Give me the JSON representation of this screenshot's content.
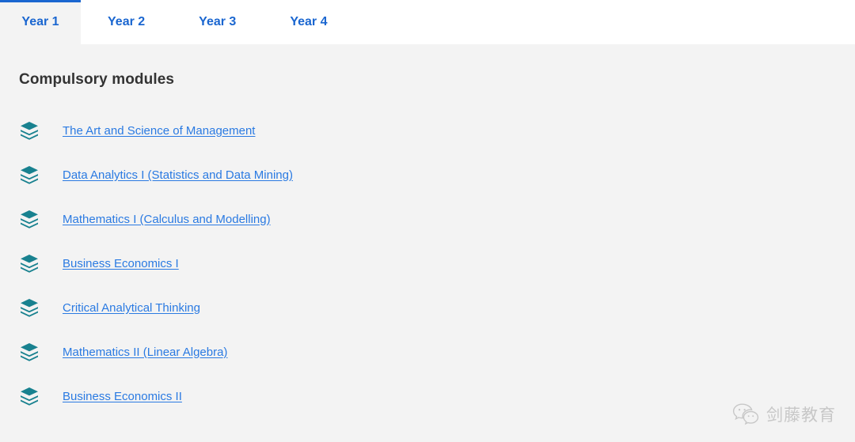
{
  "tabs": [
    {
      "label": "Year 1",
      "active": true
    },
    {
      "label": "Year 2",
      "active": false
    },
    {
      "label": "Year 3",
      "active": false
    },
    {
      "label": "Year 4",
      "active": false
    }
  ],
  "main": {
    "heading": "Compulsory modules",
    "modules": [
      {
        "label": "The Art and Science of Management",
        "icon": "layers-icon"
      },
      {
        "label": "Data Analytics I (Statistics and Data Mining)",
        "icon": "layers-icon"
      },
      {
        "label": "Mathematics I (Calculus and Modelling)",
        "icon": "layers-icon"
      },
      {
        "label": "Business Economics I",
        "icon": "layers-icon"
      },
      {
        "label": "Critical Analytical Thinking",
        "icon": "layers-icon"
      },
      {
        "label": "Mathematics II (Linear Algebra)",
        "icon": "layers-icon"
      },
      {
        "label": "Business Economics II",
        "icon": "layers-icon"
      }
    ]
  },
  "watermark": {
    "text": "剑藤教育",
    "icon": "wechat-icon"
  },
  "colors": {
    "accent_blue": "#1a66d0",
    "link_blue": "#2a7ae2",
    "icon_teal": "#18818f",
    "page_background": "#f3f3f3",
    "tabbar_background": "#ffffff",
    "heading_text": "#333333"
  }
}
